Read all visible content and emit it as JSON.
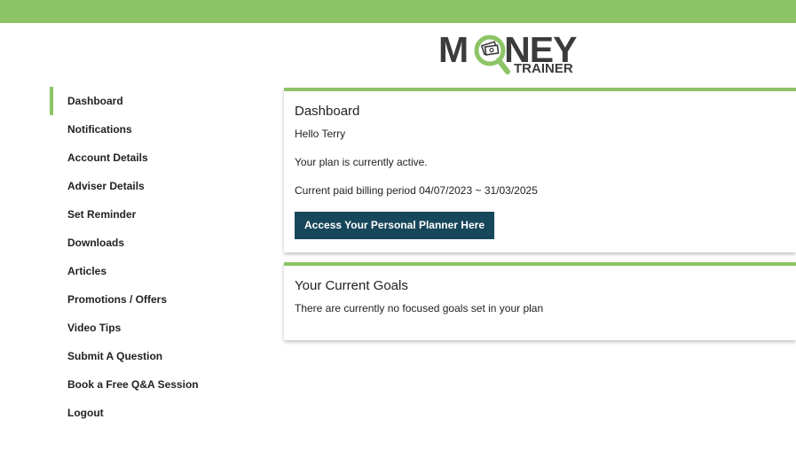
{
  "brand": {
    "logo_word": "M",
    "logo_word_rest": "NEY",
    "logo_sub": "TRAINER",
    "colors": {
      "accent_green": "#8cc466",
      "button_dark": "#17475a",
      "logo_text": "#3b3b3b"
    }
  },
  "sidebar": {
    "items": [
      {
        "label": "Dashboard",
        "active": true
      },
      {
        "label": "Notifications"
      },
      {
        "label": "Account Details"
      },
      {
        "label": "Adviser Details"
      },
      {
        "label": "Set Reminder"
      },
      {
        "label": "Downloads"
      },
      {
        "label": "Articles"
      },
      {
        "label": "Promotions / Offers"
      },
      {
        "label": "Video Tips"
      },
      {
        "label": "Submit A Question"
      },
      {
        "label": "Book a Free Q&A Session"
      },
      {
        "label": "Logout"
      }
    ]
  },
  "dashboard": {
    "title": "Dashboard",
    "greeting": "Hello Terry",
    "plan_status": "Your plan is currently active.",
    "billing_period": "Current paid billing period 04/07/2023 ~ 31/03/2025",
    "cta_label": "Access Your Personal Planner Here"
  },
  "goals": {
    "title": "Your Current Goals",
    "message": "There are currently no focused goals set in your plan"
  }
}
